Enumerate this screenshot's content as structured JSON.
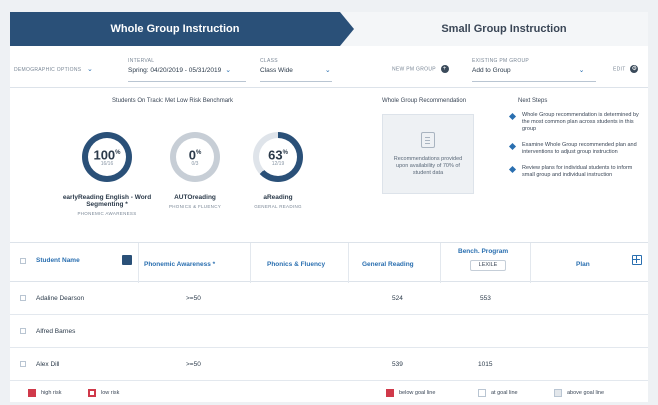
{
  "tabs": {
    "active": "Whole Group Instruction",
    "inactive": "Small Group Instruction"
  },
  "filters": {
    "demographic": "DEMOGRAPHIC OPTIONS",
    "interval_label": "INTERVAL",
    "interval_value": "Spring: 04/20/2019 - 05/31/2019",
    "class_label": "CLASS",
    "class_value": "Class Wide",
    "new_group": "NEW PM GROUP",
    "existing_label": "EXISTING PM GROUP",
    "existing_value": "Add to Group",
    "edit": "EDIT"
  },
  "summary": {
    "benchmark_title": "Students On Track: Met Low Risk Benchmark",
    "gauges": [
      {
        "pct": "100",
        "sub": "16/16",
        "name": "earlyReading English - Word Segmenting *",
        "cap": "PHONEMIC AWARENESS",
        "color": "#2a5078"
      },
      {
        "pct": "0",
        "sub": "0/3",
        "name": "AUTOreading",
        "cap": "PHONICS & FLUENCY",
        "color": "#c7ced6"
      },
      {
        "pct": "63",
        "sub": "12/19",
        "name": "aReading",
        "cap": "GENERAL READING",
        "color": "#2a5078",
        "fraction": 0.63
      }
    ],
    "recommendation_title": "Whole Group Recommendation",
    "recommendation_text": "Recommendations provided upon availability of 70% of student data",
    "next_steps_title": "Next Steps",
    "next_steps": [
      "Whole Group recommendation is determined by the most common plan across students in this group",
      "Examine Whole Group recommended plan and interventions to adjust group instruction",
      "Review plans for individual students to inform small group and individual instruction"
    ]
  },
  "table": {
    "headers": {
      "student": "Student Name",
      "pa": "Phonemic Awareness *",
      "pf": "Phonics & Fluency",
      "gr": "General Reading",
      "bench": "Bench. Program",
      "bench_pill": "LEXILE",
      "plan": "Plan"
    },
    "rows": [
      {
        "name": "Adaline Dearson",
        "pa": ">=50",
        "gr": "524",
        "bench": "553"
      },
      {
        "name": "Alfred Barnes",
        "pa": "",
        "gr": "",
        "bench": ""
      },
      {
        "name": "Alex Dill",
        "pa": ">=50",
        "gr": "539",
        "bench": "1015"
      }
    ]
  },
  "legend": {
    "high": "high risk",
    "low": "low risk",
    "below": "below goal line",
    "at": "at goal line",
    "above": "above goal line"
  }
}
